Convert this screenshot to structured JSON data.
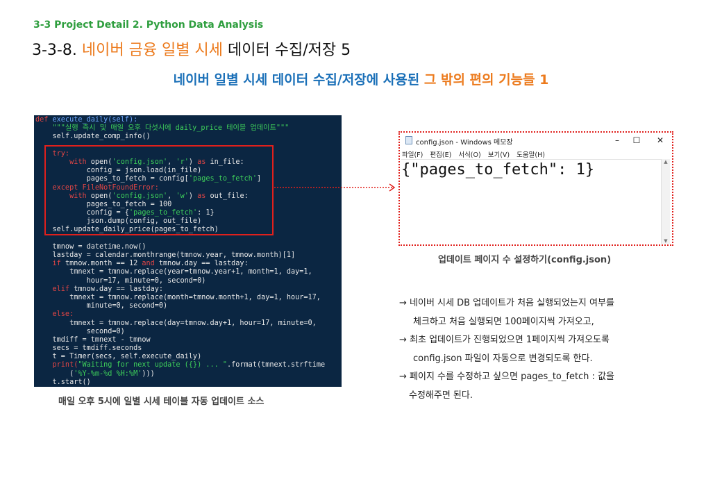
{
  "header": {
    "sup_title": "3-3 Project Detail 2. Python Data Analysis",
    "title_prefix": "3-3-8.",
    "title_highlight": "네이버 금융 일별 시세",
    "title_rest": "데이터 수집/저장 5",
    "subtitle_main": "네이버 일별 시세 데이터 수집/저장에 사용된",
    "subtitle_highlight": "그 밖의 편의 기능들 1"
  },
  "code": {
    "caption": "매일 오후 5시에 일별 시세 테이블 자동 업데이트 소스",
    "lines": {
      "l1a": "def",
      "l1b": " execute_daily(self):",
      "l2": "    \"\"\"실행 즉시 및 매일 오후 다섯시에 daily_price 테이블 업데이트\"\"\"",
      "l3": "    self.update_comp_info()",
      "l5": "    try:",
      "l6a": "        with",
      "l6b": " open(",
      "l6c": "'config.json'",
      "l6d": ", ",
      "l6e": "'r'",
      "l6f": ") ",
      "l6g": "as",
      "l6h": " in_file:",
      "l7": "            config = json.load(in_file)",
      "l8a": "            pages_to_fetch = config[",
      "l8b": "'pages_to_fetch'",
      "l8c": "]",
      "l9a": "    except",
      "l9b": " FileNotFoundError:",
      "l10a": "        with",
      "l10b": " open(",
      "l10c": "'config.json'",
      "l10d": ", ",
      "l10e": "'w'",
      "l10f": ") ",
      "l10g": "as",
      "l10h": " out_file:",
      "l11": "            pages_to_fetch = 100",
      "l12a": "            config = {",
      "l12b": "'pages_to_fetch'",
      "l12c": ": 1}",
      "l13": "            json.dump(config, out_file)",
      "l14": "    self.update_daily_price(pages_to_fetch)",
      "l16": "    tmnow = datetime.now()",
      "l17": "    lastday = calendar.monthrange(tmnow.year, tmnow.month)[1]",
      "l18a": "    if",
      "l18b": " tmnow.month == 12 ",
      "l18c": "and",
      "l18d": " tmnow.day == lastday:",
      "l19": "        tmnext = tmnow.replace(year=tmnow.year+1, month=1, day=1,",
      "l20": "            hour=17, minute=0, second=0)",
      "l21a": "    elif",
      "l21b": " tmnow.day == lastday:",
      "l22": "        tmnext = tmnow.replace(month=tmnow.month+1, day=1, hour=17,",
      "l23": "            minute=0, second=0)",
      "l24": "    else:",
      "l25": "        tmnext = tmnow.replace(day=tmnow.day+1, hour=17, minute=0,",
      "l26": "            second=0)",
      "l27": "    tmdiff = tmnext - tmnow",
      "l28": "    secs = tmdiff.seconds",
      "l29": "    t = Timer(secs, self.execute_daily)",
      "l30a": "    print(",
      "l30b": "\"Waiting for next update ({}) ... \"",
      "l30c": ".format(tmnext.strftime",
      "l31a": "        (",
      "l31b": "'%Y-%m-%d %H:%M'",
      "l31c": ")))",
      "l32": "    t.start()"
    }
  },
  "notepad": {
    "window_title": "config.json - Windows 메모장",
    "menu": [
      "파일(F)",
      "편집(E)",
      "서식(O)",
      "보기(V)",
      "도움말(H)"
    ],
    "content": "{\"pages_to_fetch\": 1}",
    "caption": "업데이트 페이지 수 설정하기(config.json)"
  },
  "notes": {
    "n1": "→ 네이버 시세 DB 업데이트가 처음 실행되었는지 여부를",
    "n1b": "체크하고 처음 실행되면 100페이지씩 가져오고,",
    "n2": "→ 최초 업데이트가 진행되었으면 1페이지씩 가져오도록",
    "n2b": "config.json 파일이 자동으로 변경되도록 한다.",
    "n3": "→ 페이지 수를 수정하고 싶으면 pages_to_fetch : 값을",
    "n3b": "수정해주면 된다."
  },
  "colors": {
    "accent_orange": "#ec7a1c",
    "accent_blue": "#1b70b8",
    "accent_green": "#2e9e3e",
    "highlight_red": "#e0201c",
    "code_bg": "#0b2642"
  }
}
